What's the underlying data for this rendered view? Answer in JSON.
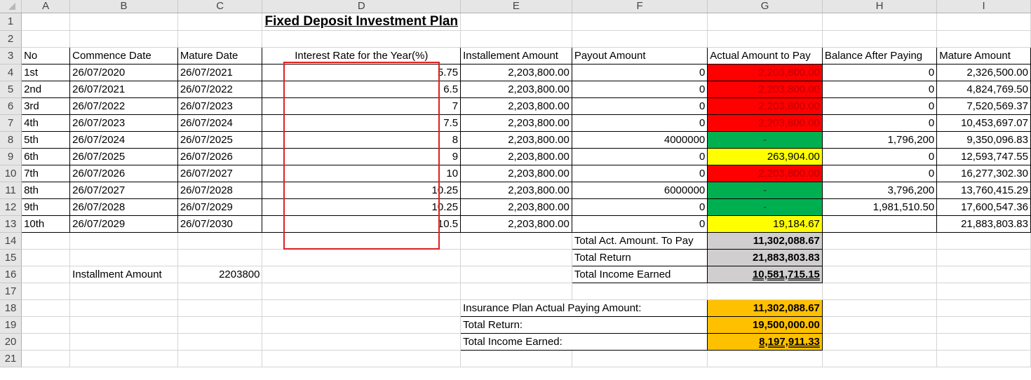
{
  "title": "Fixed Deposit Investment Plan",
  "columns": [
    "A",
    "B",
    "C",
    "D",
    "E",
    "F",
    "G",
    "H",
    "I"
  ],
  "row_numbers": [
    "1",
    "2",
    "3",
    "4",
    "5",
    "6",
    "7",
    "8",
    "9",
    "10",
    "11",
    "12",
    "13",
    "14",
    "15",
    "16",
    "17",
    "18",
    "19",
    "20",
    "21"
  ],
  "headers": {
    "no": "No",
    "commence": "Commence Date",
    "mature": "Mature Date",
    "rate": "Interest Rate for the Year(%)",
    "installment": "Installement Amount",
    "payout": "Payout Amount",
    "actual": "Actual Amount to Pay",
    "balance": "Balance After Paying",
    "mature_amount": "Mature Amount"
  },
  "rows": [
    {
      "no": "1st",
      "commence": "26/07/2020",
      "mature": "26/07/2021",
      "rate": "5.75",
      "installment": "2,203,800.00",
      "payout": "0",
      "actual": "2,203,800.00",
      "balance": "0",
      "mature_amount": "2,326,500.00"
    },
    {
      "no": "2nd",
      "commence": "26/07/2021",
      "mature": "26/07/2022",
      "rate": "6.5",
      "installment": "2,203,800.00",
      "payout": "0",
      "actual": "2,203,800.00",
      "balance": "0",
      "mature_amount": "4,824,769.50"
    },
    {
      "no": "3rd",
      "commence": "26/07/2022",
      "mature": "26/07/2023",
      "rate": "7",
      "installment": "2,203,800.00",
      "payout": "0",
      "actual": "2,203,800.00",
      "balance": "0",
      "mature_amount": "7,520,569.37"
    },
    {
      "no": "4th",
      "commence": "26/07/2023",
      "mature": "26/07/2024",
      "rate": "7.5",
      "installment": "2,203,800.00",
      "payout": "0",
      "actual": "2,203,800.00",
      "balance": "0",
      "mature_amount": "10,453,697.07"
    },
    {
      "no": "5th",
      "commence": "26/07/2024",
      "mature": "26/07/2025",
      "rate": "8",
      "installment": "2,203,800.00",
      "payout": "4000000",
      "actual": "-",
      "balance": "1,796,200",
      "mature_amount": "9,350,096.83"
    },
    {
      "no": "6th",
      "commence": "26/07/2025",
      "mature": "26/07/2026",
      "rate": "9",
      "installment": "2,203,800.00",
      "payout": "0",
      "actual": "263,904.00",
      "balance": "0",
      "mature_amount": "12,593,747.55"
    },
    {
      "no": "7th",
      "commence": "26/07/2026",
      "mature": "26/07/2027",
      "rate": "10",
      "installment": "2,203,800.00",
      "payout": "0",
      "actual": "2,203,800.00",
      "balance": "0",
      "mature_amount": "16,277,302.30"
    },
    {
      "no": "8th",
      "commence": "26/07/2027",
      "mature": "26/07/2028",
      "rate": "10.25",
      "installment": "2,203,800.00",
      "payout": "6000000",
      "actual": "-",
      "balance": "3,796,200",
      "mature_amount": "13,760,415.29"
    },
    {
      "no": "9th",
      "commence": "26/07/2028",
      "mature": "26/07/2029",
      "rate": "10.25",
      "installment": "2,203,800.00",
      "payout": "0",
      "actual": "-",
      "balance": "1,981,510.50",
      "mature_amount": "17,600,547.36"
    },
    {
      "no": "10th",
      "commence": "26/07/2029",
      "mature": "26/07/2030",
      "rate": "10.5",
      "installment": "2,203,800.00",
      "payout": "0",
      "actual": "19,184.67",
      "balance": "",
      "mature_amount": "21,883,803.83"
    }
  ],
  "actual_status": [
    "red",
    "red",
    "red",
    "red",
    "green",
    "yellow",
    "red",
    "green",
    "green",
    "yellow"
  ],
  "totals": {
    "act_label": "Total Act. Amount. To Pay",
    "act_value": "11,302,088.67",
    "return_label": "Total Return",
    "return_value": "21,883,803.83",
    "income_label": "Total Income Earned",
    "income_value": "10,581,715.15"
  },
  "installment": {
    "label": "Installment Amount",
    "value": "2203800"
  },
  "insurance": {
    "pay_label": "Insurance Plan Actual Paying Amount:",
    "pay_value": "11,302,088.67",
    "return_label": "Total Return:",
    "return_value": "19,500,000.00",
    "income_label": "Total Income Earned:",
    "income_value": "8,197,911.33"
  },
  "colors": {
    "red": "#ff0000",
    "green": "#00b050",
    "yellow": "#ffff00",
    "gray": "#d0cece",
    "orange": "#ffc000",
    "highlight": "#e02020"
  }
}
